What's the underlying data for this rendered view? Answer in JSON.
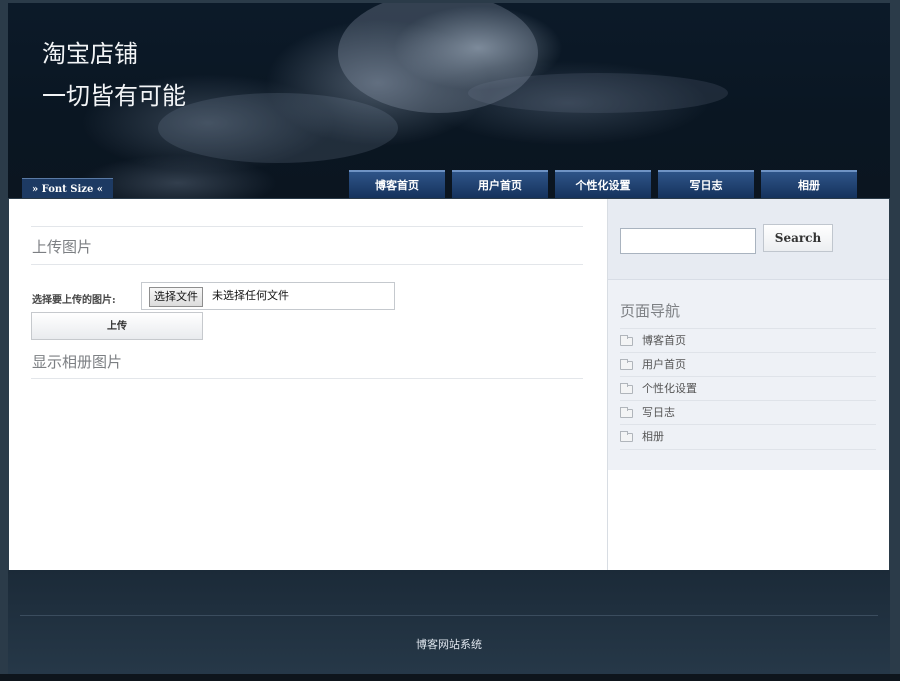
{
  "header": {
    "title_line1": "淘宝店铺",
    "title_line2": "一切皆有可能",
    "font_size_label": "» Font Size «",
    "nav": [
      "博客首页",
      "用户首页",
      "个性化设置",
      "写日志",
      "相册"
    ]
  },
  "main": {
    "upload_heading": "上传图片",
    "upload_label": "选择要上传的图片:",
    "file_button": "选择文件",
    "file_status": "未选择任何文件",
    "upload_button": "上传",
    "album_heading": "显示相册图片"
  },
  "sidebar": {
    "search_value": "",
    "search_button": "Search",
    "nav_heading": "页面导航",
    "nav_items": [
      "博客首页",
      "用户首页",
      "个性化设置",
      "写日志",
      "相册"
    ]
  },
  "footer": {
    "text": "博客网站系统"
  },
  "colors": {
    "header_bg": "#0c1a29",
    "nav_tab": "#1d3a63",
    "sidebar_bg": "#eef1f6",
    "footer_bg": "#1f2f3d"
  }
}
